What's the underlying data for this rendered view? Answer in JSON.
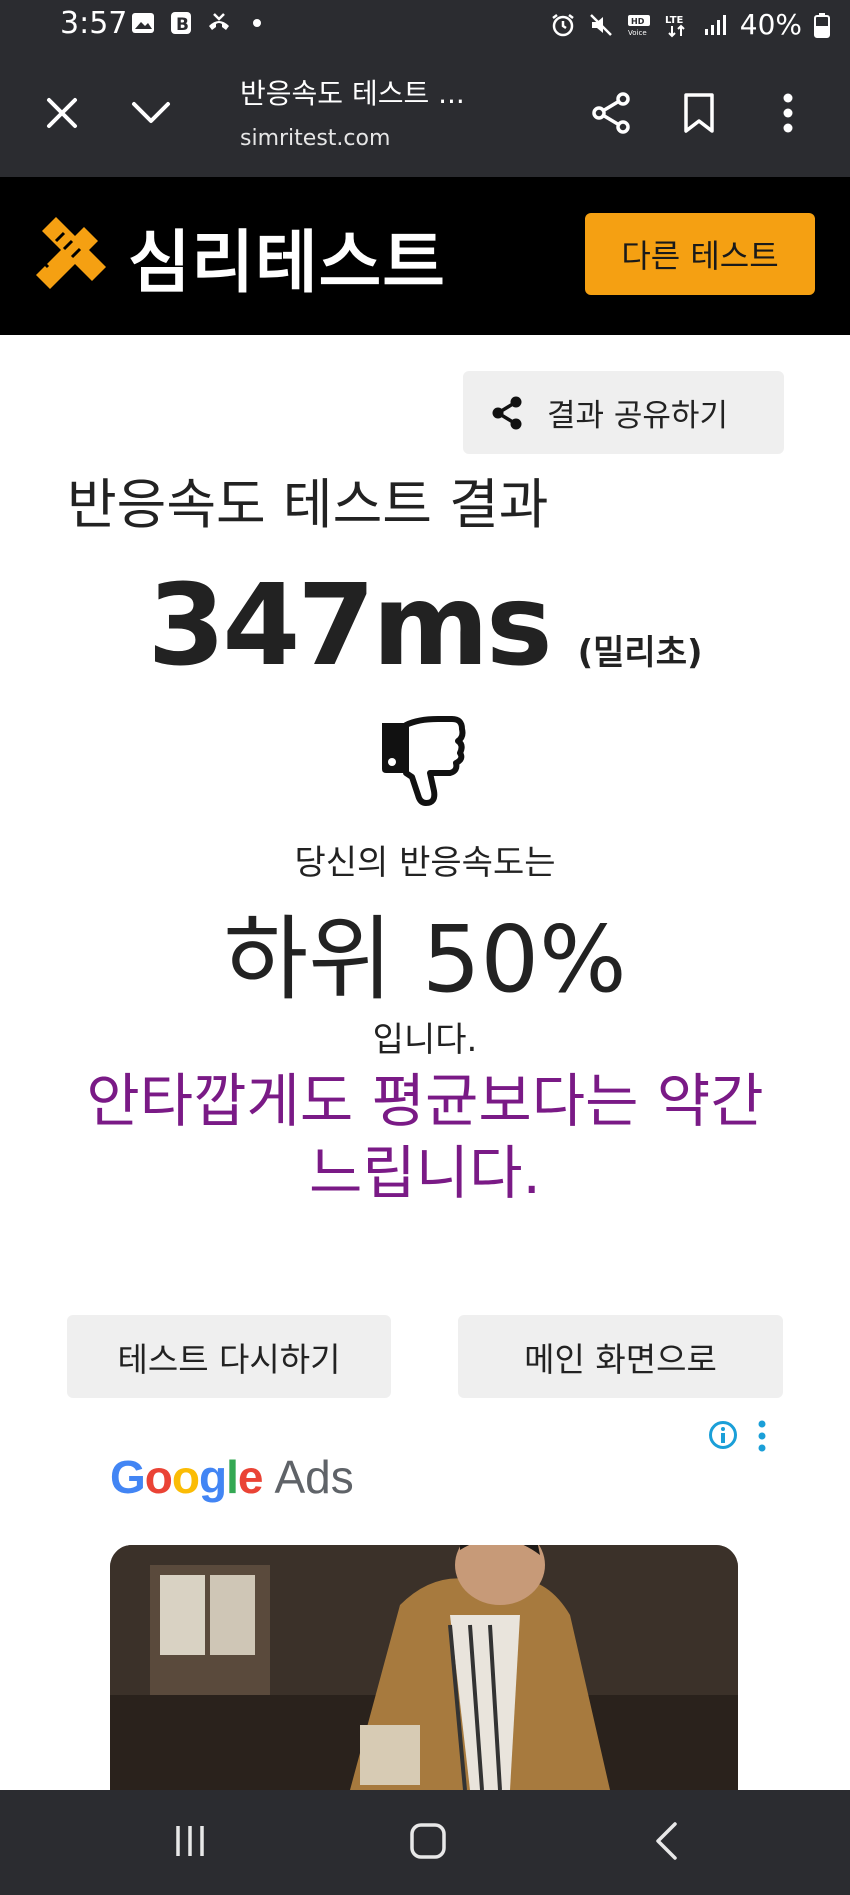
{
  "status_bar": {
    "time": "3:57",
    "battery": "40%",
    "network": "LTE"
  },
  "browser": {
    "page_title": "반응속도 테스트 ...",
    "url": "simritest.com"
  },
  "site": {
    "logo_text": "심리테스트",
    "other_test_label": "다른 테스트",
    "accent_color": "#f5a012"
  },
  "result": {
    "share_label": "결과 공유하기",
    "title": "반응속도 테스트 결과",
    "score": "347ms",
    "score_unit": "(밀리초)",
    "intro": "당신의 반응속도는",
    "rank": "하위 50%",
    "outro": "입니다.",
    "comment": "안타깝게도 평균보다는 약간 느립니다.",
    "comment_color": "#7a1a86"
  },
  "actions": {
    "retry_label": "테스트 다시하기",
    "main_label": "메인 화면으로"
  },
  "ad": {
    "brand_google": "Google",
    "brand_ads": "Ads"
  }
}
